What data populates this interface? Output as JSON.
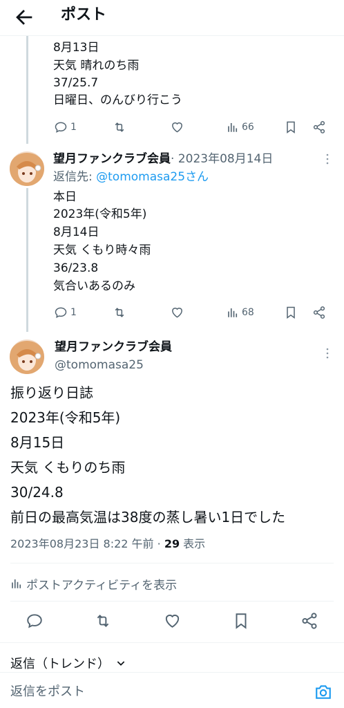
{
  "header": {
    "title": "ポスト"
  },
  "prev_tweet": {
    "lines": [
      "8月13日",
      "天気 晴れのち雨",
      "37/25.7",
      "日曜日、のんびり行こう"
    ],
    "replies": "1",
    "views": "66"
  },
  "reply_tweet": {
    "author": "望月ファンクラブ会員",
    "date": "· 2023年08月14日",
    "reply_to_prefix": "返信先: ",
    "reply_to_handle": "@tomomasa25さん",
    "lines": [
      "本日",
      "2023年(令和5年)",
      "8月14日",
      "天気 くもり時々雨",
      "36/23.8",
      "気合いあるのみ"
    ],
    "replies": "1",
    "views": "68"
  },
  "main_tweet": {
    "author": "望月ファンクラブ会員",
    "handle": "@tomomasa25",
    "lines": [
      "振り返り日誌",
      "2023年(令和5年)",
      "8月15日",
      "天気 くもりのち雨",
      "30/24.8",
      "前日の最高気温は38度の蒸し暑い1日でした"
    ],
    "timestamp": "2023年08月23日 8:22 午前 · ",
    "views_count": "29",
    "views_label": " 表示",
    "activity_label": "ポストアクティビティを表示"
  },
  "replies_sort": {
    "label": "返信（トレンド）"
  },
  "composer": {
    "placeholder": "返信をポスト"
  },
  "colors": {
    "link": "#1d9bf0",
    "muted": "#536471",
    "thread_line": "#cfd9de"
  }
}
